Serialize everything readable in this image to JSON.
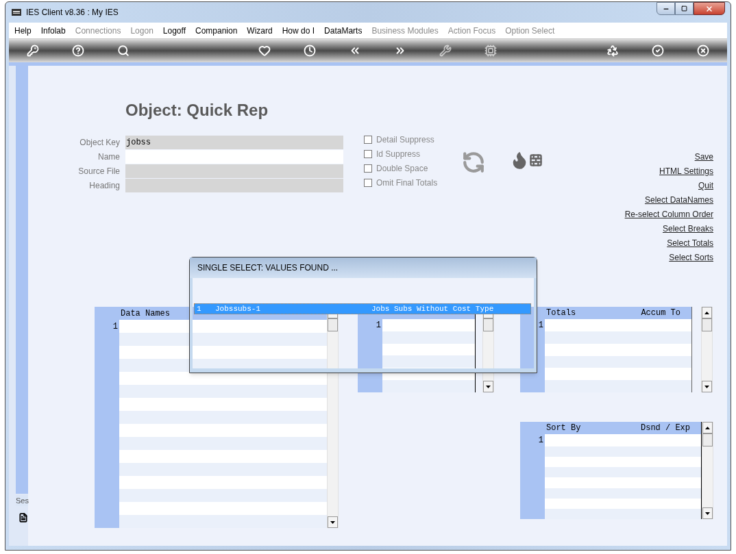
{
  "window": {
    "title": "IES Client v8.36 : My IES"
  },
  "menu": [
    {
      "label": "Help",
      "disabled": false
    },
    {
      "label": "Infolab",
      "disabled": false
    },
    {
      "label": "Connections",
      "disabled": true
    },
    {
      "label": "Logon",
      "disabled": true
    },
    {
      "label": "Logoff",
      "disabled": false
    },
    {
      "label": "Companion",
      "disabled": false
    },
    {
      "label": "Wizard",
      "disabled": false
    },
    {
      "label": "How do I",
      "disabled": false
    },
    {
      "label": "DataMarts",
      "disabled": false
    },
    {
      "label": "Business Modules",
      "disabled": true
    },
    {
      "label": "Action Focus",
      "disabled": true
    },
    {
      "label": "Option Select",
      "disabled": true
    }
  ],
  "form": {
    "title": "Object: Quick Rep",
    "fields": [
      {
        "label": "Object Key",
        "value": "jobss",
        "disabled": true
      },
      {
        "label": "Name",
        "disabled": false
      },
      {
        "label": "Source File",
        "disabled": true
      },
      {
        "label": "Heading",
        "disabled": true
      }
    ],
    "options": [
      {
        "label": "Detail Suppress",
        "checked": false
      },
      {
        "label": "Id Suppress",
        "checked": false
      },
      {
        "label": "Double Space",
        "checked": false
      },
      {
        "label": "Omit Final Totals",
        "checked": false
      }
    ],
    "links": [
      "Save",
      "HTML Settings",
      "Quit",
      "Select DataNames",
      "Re-select Column Order",
      "Select Breaks",
      "Select Totals",
      "Select Sorts"
    ]
  },
  "grids": {
    "data_names": {
      "columns": [
        "Data Names"
      ],
      "row_numbers": [
        "1"
      ]
    },
    "columns_grid": {
      "row_numbers": [
        "1"
      ]
    },
    "totals": {
      "columns": [
        "Totals",
        "Accum To"
      ],
      "row_numbers": [
        "1"
      ]
    },
    "sorts": {
      "columns": [
        "Sort By",
        "Dsnd / Exp"
      ],
      "row_numbers": [
        "1"
      ]
    }
  },
  "popup": {
    "title": "SINGLE SELECT: VALUES FOUND ...",
    "rows": [
      {
        "number": "1",
        "key": "Jobssubs-1",
        "description": "Jobs Subs Without Cost Type",
        "selected": true
      }
    ]
  },
  "side_tab": {
    "label": "Ses"
  }
}
